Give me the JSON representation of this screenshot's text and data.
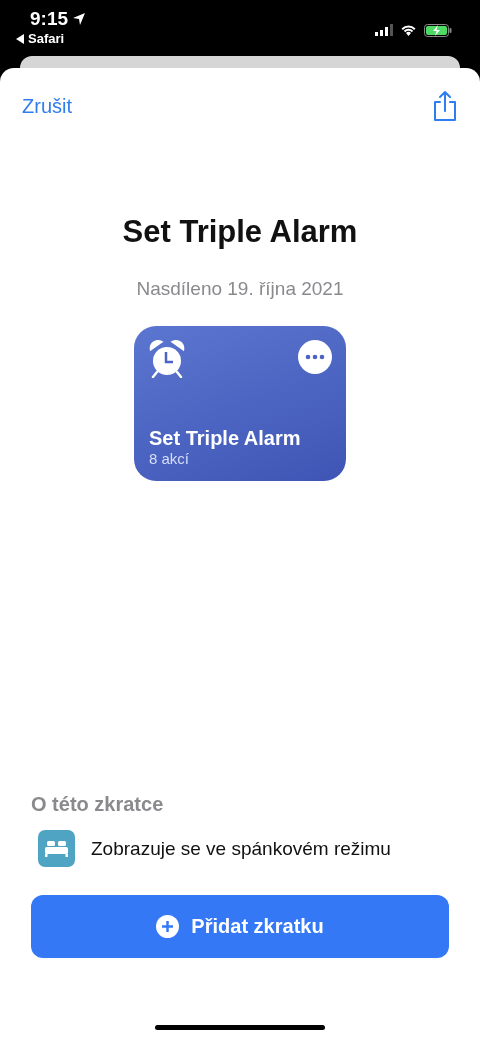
{
  "status_bar": {
    "time": "9:15",
    "back_app": "Safari"
  },
  "nav": {
    "cancel": "Zrušit"
  },
  "title": "Set Triple Alarm",
  "subtitle": "Nasdíleno 19. října 2021",
  "shortcut_card": {
    "name": "Set Triple Alarm",
    "actions": "8 akcí"
  },
  "about": {
    "heading": "O této zkratce",
    "items": [
      {
        "text": "Zobrazuje se ve spánkovém režimu"
      }
    ]
  },
  "add_button": "Přidat zkratku"
}
